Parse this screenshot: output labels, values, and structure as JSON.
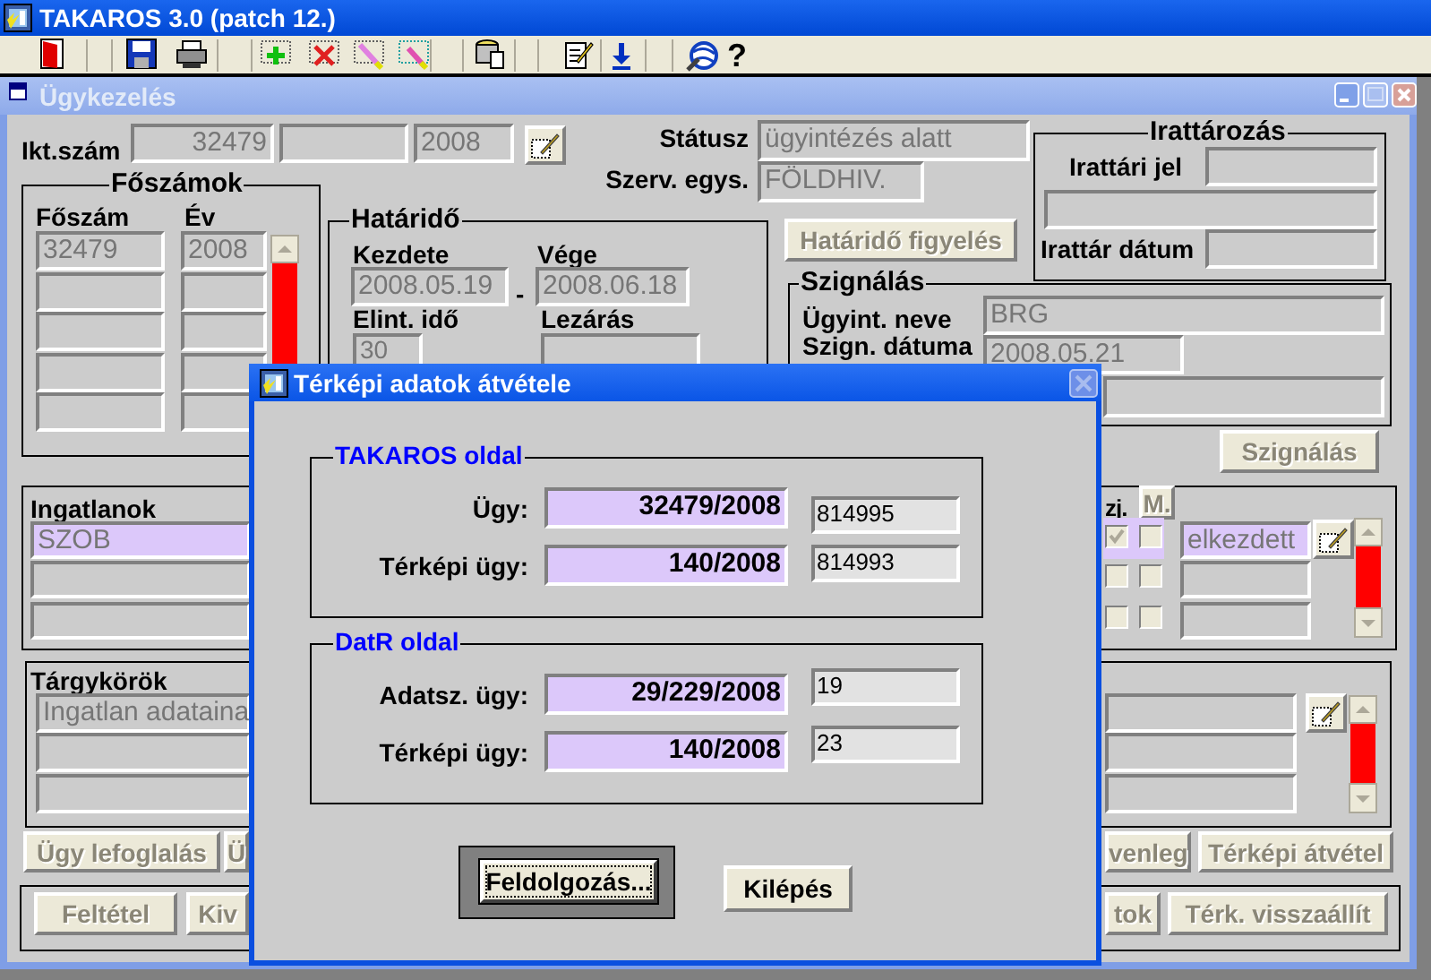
{
  "app": {
    "title": "TAKAROS 3.0 (patch 12.)",
    "help": "?"
  },
  "window": {
    "title": "Ügykezelés"
  },
  "ikt_szam": {
    "label": "Ikt.szám",
    "number": "32479",
    "year": "2008"
  },
  "statusz": {
    "label": "Státusz",
    "value": "ügyintézés alatt"
  },
  "szerv_egys": {
    "label": "Szerv. egys.",
    "value": "FÖLDHIV."
  },
  "irattarozas": {
    "title": "Irattározás",
    "irattari_jel_label": "Irattári jel",
    "irattar_datum_label": "Irattár dátum"
  },
  "foszamok": {
    "title": "Főszámok",
    "columns": [
      "Főszám",
      "Év"
    ],
    "rows": [
      {
        "foszam": "32479",
        "ev": "2008"
      }
    ]
  },
  "hatarido": {
    "title": "Határidő",
    "kezdete_label": "Kezdete",
    "kezdete": "2008.05.19",
    "separator": "-",
    "vege_label": "Vége",
    "vege": "2008.06.18",
    "elint_ido_label": "Elint. idő",
    "elint_ido": "30",
    "lezaras_label": "Lezárás"
  },
  "hatarido_figyeles_button": {
    "label": "Határidő figyelés",
    "disabled": true
  },
  "szignalas": {
    "title": "Szignálás",
    "ugyint_neve_label": "Ügyint. neve",
    "ugyint_neve": "BRG",
    "szign_datuma_label": "Szign. dátuma",
    "szign_datuma": "2008.05.21"
  },
  "szignalas_button": {
    "label": "Szignálás",
    "disabled": true
  },
  "ingatlanok": {
    "title": "Ingatlanok",
    "zj_header": "zj.",
    "m_button": "M.",
    "rows": [
      {
        "name": "SZOB",
        "status": "elkezdett",
        "selected": true,
        "zj": true,
        "m": false
      },
      {
        "selected": false,
        "zj": false,
        "m": false
      },
      {
        "selected": false,
        "zj": false,
        "m": false
      }
    ]
  },
  "targykorok": {
    "title": "Tárgykörök",
    "rows": [
      {
        "value": "Ingatlan adataina"
      }
    ]
  },
  "action_buttons": [
    {
      "label": "Ügy lefoglalás",
      "disabled": true
    },
    {
      "label": "Ü",
      "disabled": true
    },
    {
      "label": "venleg",
      "disabled": true
    },
    {
      "label": "Térképi átvétel",
      "disabled": true
    }
  ],
  "bottom_buttons": [
    {
      "label": "Feltétel",
      "disabled": true
    },
    {
      "label": "Kiv",
      "disabled": true
    },
    {
      "label": "tok",
      "disabled": true
    },
    {
      "label": "Térk. visszaállít",
      "disabled": true
    }
  ],
  "dialog": {
    "title": "Térképi adatok átvétele",
    "groups": [
      {
        "title": "TAKAROS oldal",
        "rows": [
          {
            "label": "Ügy:",
            "value": "32479/2008",
            "code": "814995"
          },
          {
            "label": "Térképi ügy:",
            "value": "140/2008",
            "code": "814993"
          }
        ]
      },
      {
        "title": "DatR oldal",
        "rows": [
          {
            "label": "Adatsz. ügy:",
            "value": "29/229/2008",
            "code": "19"
          },
          {
            "label": "Térképi ügy:",
            "value": "140/2008",
            "code": "23"
          }
        ]
      }
    ],
    "buttons": [
      {
        "label": "Feldolgozás...",
        "focused": true
      },
      {
        "label": "Kilépés",
        "focused": false
      }
    ]
  }
}
